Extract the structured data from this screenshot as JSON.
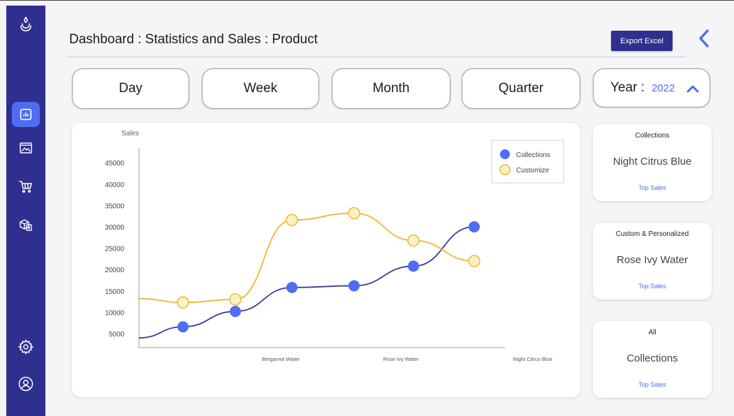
{
  "header": {
    "title": "Dashboard : Statistics and Sales : Product",
    "export_label": "Export Excel"
  },
  "sidebar": {
    "items": [
      {
        "icon": "logo-icon"
      },
      {
        "icon": "chart-icon",
        "active": true
      },
      {
        "icon": "image-gallery-icon"
      },
      {
        "icon": "cart-icon"
      },
      {
        "icon": "boxes-icon"
      },
      {
        "icon": "gear-icon"
      },
      {
        "icon": "user-icon"
      }
    ]
  },
  "filters": {
    "day": "Day",
    "week": "Week",
    "month": "Month",
    "quarter": "Quarter",
    "year_label": "Year :",
    "year_value": "2022"
  },
  "cards": [
    {
      "label": "Collections",
      "name": "Night Citrus Blue",
      "link": "Top Sales"
    },
    {
      "label": "Custom & Personalized",
      "name": "Rose Ivy Water",
      "link": "Top Sales"
    },
    {
      "label": "All",
      "name": "Collections",
      "link": "Top Sales"
    }
  ],
  "colors": {
    "sidebar": "#2f2f8f",
    "accent": "#4f6cf3",
    "collections_line": "#3a3a9a",
    "customize_line": "#f2b632",
    "customize_fill": "#fdf1c9"
  },
  "chart_data": {
    "type": "line",
    "ylabel": "Sales",
    "y_ticks": [
      5000,
      10000,
      15000,
      20000,
      25000,
      30000,
      35000,
      40000,
      45000
    ],
    "x_tick_labels": [
      "Bergamot Water",
      "Rose Ivy Water",
      "Night Citrus Blue"
    ],
    "legend_position": "top-right",
    "series": [
      {
        "name": "Collections",
        "points": [
          [
            0,
            4000
          ],
          [
            1,
            6600
          ],
          [
            2,
            10200
          ],
          [
            3,
            15800
          ],
          [
            4,
            16200
          ],
          [
            5,
            20800
          ],
          [
            6,
            30000
          ]
        ]
      },
      {
        "name": "Customize",
        "points": [
          [
            0,
            13200
          ],
          [
            1,
            12300
          ],
          [
            2,
            13000
          ],
          [
            3,
            31600
          ],
          [
            4,
            33200
          ],
          [
            5,
            26800
          ],
          [
            6,
            22000
          ]
        ]
      }
    ]
  }
}
